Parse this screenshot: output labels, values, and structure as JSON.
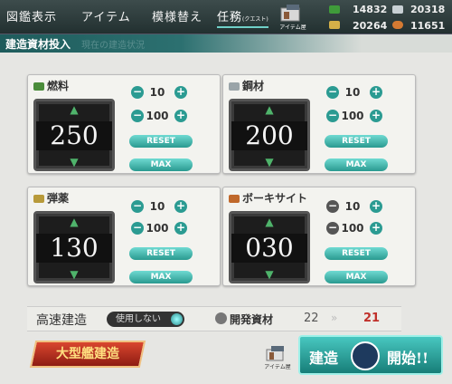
{
  "nav": {
    "tabs": [
      {
        "label": "図鑑表示"
      },
      {
        "label": "アイテム"
      },
      {
        "label": "模様替え"
      },
      {
        "label": "任務",
        "sub": "(クエスト)"
      }
    ],
    "shop_label": "アイテム屋"
  },
  "resources": {
    "fuel": "14832",
    "steel": "20318",
    "ammo": "20264",
    "bauxite": "11651"
  },
  "header": {
    "title": "建造資材投入",
    "ghost": "現在の建造状況"
  },
  "panels": [
    {
      "name": "燃料",
      "value": "250",
      "steps": [
        "10",
        "100"
      ],
      "reset": "RESET",
      "max": "MAX",
      "color": "#4a8c3a"
    },
    {
      "name": "鋼材",
      "value": "200",
      "steps": [
        "10",
        "100"
      ],
      "reset": "RESET",
      "max": "MAX",
      "color": "#9aa4a8"
    },
    {
      "name": "弾薬",
      "value": "130",
      "steps": [
        "10",
        "100"
      ],
      "reset": "RESET",
      "max": "MAX",
      "color": "#b89a3a"
    },
    {
      "name": "ボーキサイト",
      "value": "030",
      "steps": [
        "10",
        "100"
      ],
      "reset": "RESET",
      "max": "MAX",
      "color": "#c0682a"
    }
  ],
  "fast_build": {
    "label": "高速建造",
    "toggle": "使用しない"
  },
  "dev_material": {
    "label": "開発資材",
    "current": "22",
    "after": "21"
  },
  "buttons": {
    "large_build": "大型艦建造",
    "shop": "アイテム屋",
    "start_1": "建造",
    "start_2": "開始!!"
  }
}
